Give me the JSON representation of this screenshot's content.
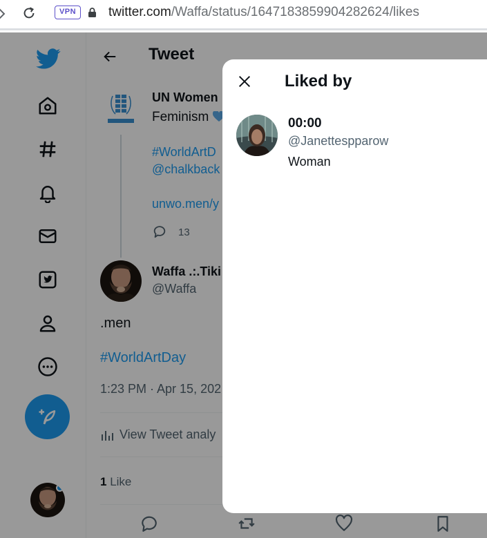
{
  "browser": {
    "vpn_badge": "VPN",
    "url_host": "twitter.com",
    "url_path": "/Waffa/status/1647183859904282624/likes"
  },
  "nav": {
    "items": [
      {
        "icon": "home-icon"
      },
      {
        "icon": "explore-icon"
      },
      {
        "icon": "notifications-icon"
      },
      {
        "icon": "messages-icon"
      },
      {
        "icon": "twitter-blue-icon"
      },
      {
        "icon": "profile-icon"
      },
      {
        "icon": "more-icon"
      }
    ],
    "compose_icon": "compose-tweet-icon"
  },
  "header": {
    "title": "Tweet"
  },
  "quoted_tweet": {
    "author": "UN Women",
    "text": "Feminism",
    "hashtag": "#WorldArtD",
    "mention": "@chalkback",
    "link": "unwo.men/y",
    "reply_count": "13"
  },
  "tweet": {
    "author": "Waffa .:.Tiki",
    "handle": "@Waffa",
    "text": ".men",
    "hashtag": "#WorldArtDay",
    "timestamp": "1:23 PM · Apr 15, 202",
    "analytics_label": "View Tweet analy",
    "likes_number": "1",
    "likes_label": "Like"
  },
  "modal": {
    "title": "Liked by",
    "likers": [
      {
        "name": "00:00",
        "handle": "@Janettespparow",
        "bio": "Woman"
      }
    ]
  },
  "colors": {
    "accent": "#1d9bf0",
    "text": "#0f1419",
    "secondary_text": "#536471",
    "vpn": "#5b4fc9"
  }
}
